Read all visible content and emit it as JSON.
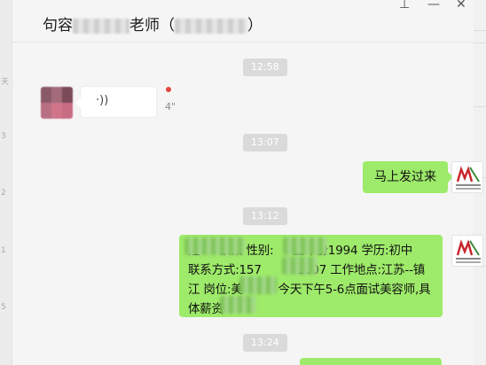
{
  "header": {
    "title_prefix": "句容",
    "title_middle": "老师（",
    "title_suffix": "）",
    "pin_icon": "pin-icon",
    "minimize_icon": "minimize-icon",
    "close_icon": "close-icon"
  },
  "left_strip": {
    "labels": [
      "天",
      "3",
      "2",
      "1",
      "5"
    ]
  },
  "messages": [
    {
      "type": "timestamp",
      "text": "12:58"
    },
    {
      "type": "voice",
      "direction": "incoming",
      "duration": "4\"",
      "unread": true
    },
    {
      "type": "timestamp",
      "text": "13:07"
    },
    {
      "type": "text",
      "direction": "outgoing",
      "text": "马上发过来"
    },
    {
      "type": "timestamp",
      "text": "13:12"
    },
    {
      "type": "text",
      "direction": "outgoing",
      "lines": [
        "姓  　 家顶 性别:  　 生年份1994 学历:初中",
        "联系方式:157　　　1607 工作地点:江苏--镇",
        "江 岗位:美　　　今天下午5-6点面试美容师,具",
        "体薪资"
      ]
    },
    {
      "type": "timestamp",
      "text": "13:24"
    }
  ],
  "colors": {
    "background": "#f5f5f5",
    "bubble_outgoing": "#9eea6a",
    "bubble_incoming": "#ffffff",
    "timestamp_bg": "#dadada",
    "unread_dot": "#e0463c"
  }
}
